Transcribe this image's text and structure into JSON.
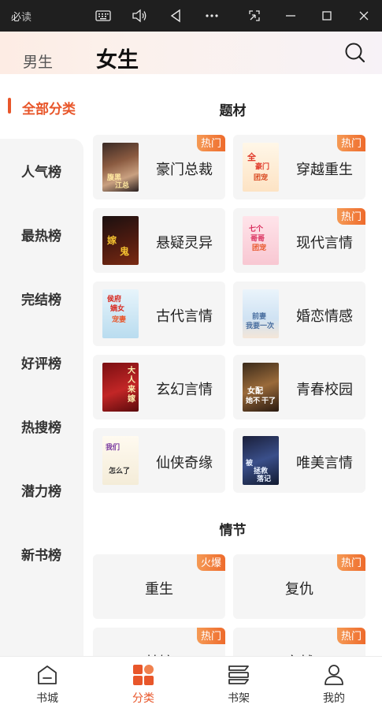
{
  "window": {
    "title": "必",
    "title_suffix": "读"
  },
  "header": {
    "tab_male": "男生",
    "tab_female": "女生"
  },
  "sidebar": {
    "selected": "全部分类",
    "items": [
      "人气榜",
      "最热榜",
      "完结榜",
      "好评榜",
      "热搜榜",
      "潜力榜",
      "新书榜"
    ]
  },
  "sections": {
    "theme_title": "题材",
    "plot_title": "情节"
  },
  "themes": [
    {
      "name": "豪门总裁",
      "badge": "热门"
    },
    {
      "name": "穿越重生",
      "badge": "热门"
    },
    {
      "name": "悬疑灵异",
      "badge": ""
    },
    {
      "name": "现代言情",
      "badge": "热门"
    },
    {
      "name": "古代言情",
      "badge": ""
    },
    {
      "name": "婚恋情感",
      "badge": ""
    },
    {
      "name": "玄幻言情",
      "badge": ""
    },
    {
      "name": "青春校园",
      "badge": ""
    },
    {
      "name": "仙侠奇缘",
      "badge": ""
    },
    {
      "name": "唯美言情",
      "badge": ""
    }
  ],
  "plots": [
    {
      "name": "重生",
      "badge": "火爆"
    },
    {
      "name": "复仇",
      "badge": "热门"
    },
    {
      "name": "替嫁",
      "badge": "热门"
    },
    {
      "name": "穿越",
      "badge": "热门"
    }
  ],
  "covers": {
    "c1": [
      "腹黑",
      "江总"
    ],
    "c2": [
      "全",
      "豪门",
      "团宠"
    ],
    "c3": [
      "嫁",
      "鬼"
    ],
    "c4": [
      "七个",
      "哥哥",
      "团宠"
    ],
    "c5": [
      "侯府",
      "嫡女",
      "宠妻"
    ],
    "c6": [
      "前妻",
      "我要一次"
    ],
    "c7": [
      "大",
      "人",
      "来",
      "嫁"
    ],
    "c8": [
      "女配",
      "她不",
      "干了"
    ],
    "c9": [
      "我们",
      "怎么了"
    ],
    "c10": [
      "被",
      "拯救",
      "落记"
    ]
  },
  "bottom_nav": [
    {
      "label": "书城"
    },
    {
      "label": "分类"
    },
    {
      "label": "书架"
    },
    {
      "label": "我的"
    }
  ],
  "colors": {
    "accent": "#e8562a",
    "badge": "#ee6b2c",
    "card_bg": "#f5f5f5"
  }
}
